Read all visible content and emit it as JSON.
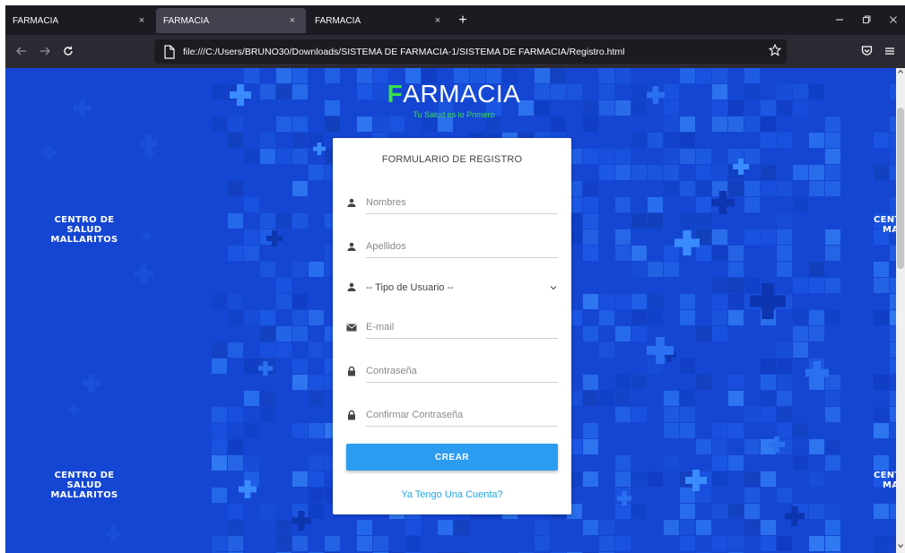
{
  "browser": {
    "tabs": [
      {
        "label": "FARMACIA",
        "active": false
      },
      {
        "label": "FARMACIA",
        "active": true
      },
      {
        "label": "FARMACIA",
        "active": false
      }
    ],
    "new_tab_symbol": "+",
    "close_symbol": "×",
    "url": "file:///C:/Users/BRUNO30/Downloads/SISTEMA DE FARMACIA-1/SISTEMA DE FARMACIA/Registro.html",
    "icons": [
      "back-icon",
      "forward-icon",
      "reload-icon",
      "page-icon",
      "bookmark-star-icon",
      "pocket-icon",
      "menu-icon",
      "minimize-icon",
      "restore-icon",
      "close-window-icon"
    ]
  },
  "background": {
    "hospital_line1": "CENTRO DE SALUD",
    "hospital_line2": "MALLARITOS",
    "hospital_cut_line1": "CENT",
    "hospital_cut_line2": "MA",
    "color": "#1546d3"
  },
  "brand": {
    "first_letter": "F",
    "rest": "ARMACIA",
    "tagline": "Tu Salud es lo Primero",
    "accent": "#39e04b"
  },
  "form": {
    "title": "FORMULARIO DE REGISTRO",
    "fields": {
      "nombres": {
        "placeholder": "Nombres",
        "icon": "user-icon"
      },
      "apellidos": {
        "placeholder": "Apellidos",
        "icon": "user-icon"
      },
      "tipo_usuario": {
        "selected": "-- Tipo de Usuario --",
        "icon": "user-icon"
      },
      "email": {
        "placeholder": "E-mail",
        "icon": "envelope-icon"
      },
      "password": {
        "placeholder": "Contraseña",
        "icon": "lock-icon"
      },
      "password_confirm": {
        "placeholder": "Confirmar Contraseña",
        "icon": "lock-icon"
      }
    },
    "submit_label": "CREAR",
    "submit_color": "#2c9cf0",
    "login_link": "Ya Tengo Una Cuenta?"
  }
}
